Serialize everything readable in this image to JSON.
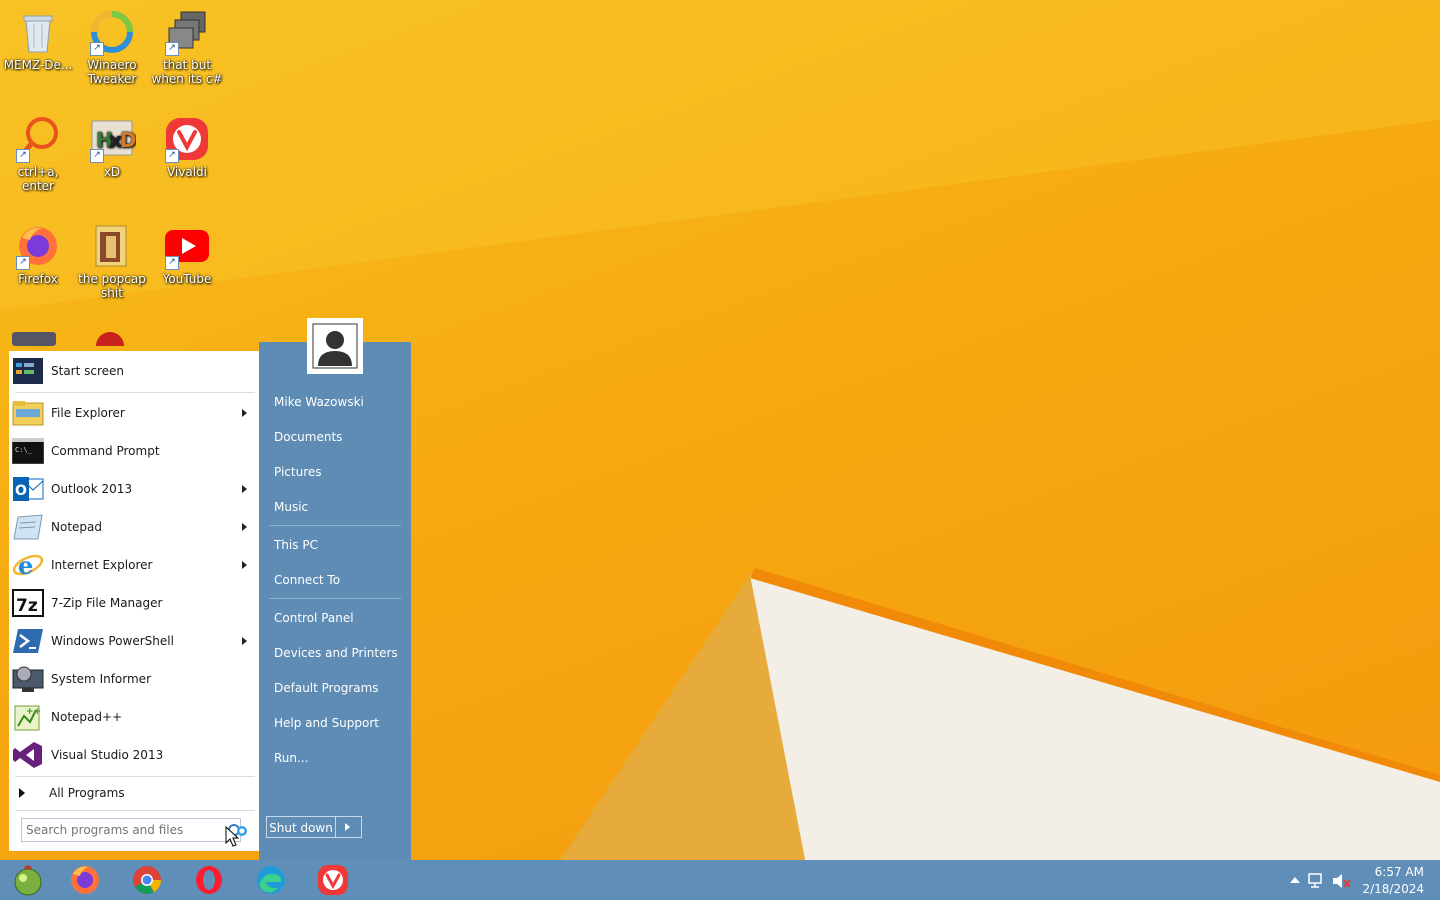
{
  "desktop": {
    "icons": [
      {
        "label": "MEMZ-De...",
        "icon": "recycle-bin-icon"
      },
      {
        "label": "Winaero Tweaker",
        "icon": "winaero-tweaker-icon"
      },
      {
        "label": "that but when its c#",
        "icon": "stacked-windows-icon"
      },
      {
        "label": "ctrl+a, enter",
        "icon": "magnifier-icon"
      },
      {
        "label": "xD",
        "icon": "hxd-icon"
      },
      {
        "label": "Vivaldi",
        "icon": "vivaldi-icon"
      },
      {
        "label": "Firefox",
        "icon": "firefox-icon"
      },
      {
        "label": "the popcap shit",
        "icon": "folder-icon"
      },
      {
        "label": "YouTube",
        "icon": "youtube-icon"
      }
    ]
  },
  "start_menu": {
    "programs": [
      {
        "label": "Start screen",
        "icon": "start-screen-icon",
        "submenu": false
      },
      {
        "label": "File Explorer",
        "icon": "file-explorer-icon",
        "submenu": true
      },
      {
        "label": "Command Prompt",
        "icon": "command-prompt-icon",
        "submenu": false
      },
      {
        "label": "Outlook 2013",
        "icon": "outlook-icon",
        "submenu": true
      },
      {
        "label": "Notepad",
        "icon": "notepad-icon",
        "submenu": true
      },
      {
        "label": "Internet Explorer",
        "icon": "internet-explorer-icon",
        "submenu": true
      },
      {
        "label": "7-Zip File Manager",
        "icon": "7zip-icon",
        "submenu": false
      },
      {
        "label": "Windows PowerShell",
        "icon": "powershell-icon",
        "submenu": true
      },
      {
        "label": "System Informer",
        "icon": "system-informer-icon",
        "submenu": false
      },
      {
        "label": "Notepad++",
        "icon": "notepad-plus-plus-icon",
        "submenu": false
      },
      {
        "label": "Visual Studio 2013",
        "icon": "visual-studio-icon",
        "submenu": false
      }
    ],
    "all_programs_label": "All Programs",
    "search_placeholder": "Search programs and files",
    "right_items": [
      "Mike Wazowski",
      "Documents",
      "Pictures",
      "Music",
      "This PC",
      "Connect To",
      "Control Panel",
      "Devices and Printers",
      "Default Programs",
      "Help and Support",
      "Run..."
    ],
    "shutdown_label": "Shut down"
  },
  "taskbar": {
    "pinned": [
      {
        "name": "start-orb",
        "icon": "start-orb-icon"
      },
      {
        "name": "firefox",
        "icon": "firefox-icon"
      },
      {
        "name": "chrome",
        "icon": "chrome-icon"
      },
      {
        "name": "opera",
        "icon": "opera-icon"
      },
      {
        "name": "edge",
        "icon": "edge-icon"
      },
      {
        "name": "vivaldi",
        "icon": "vivaldi-icon"
      }
    ],
    "clock_time": "6:57 AM",
    "clock_date": "2/18/2024"
  },
  "colors": {
    "wallpaper": "#f6aa10",
    "menu_right_pane": "#5e8cb4",
    "taskbar": "#5f8eb8"
  }
}
